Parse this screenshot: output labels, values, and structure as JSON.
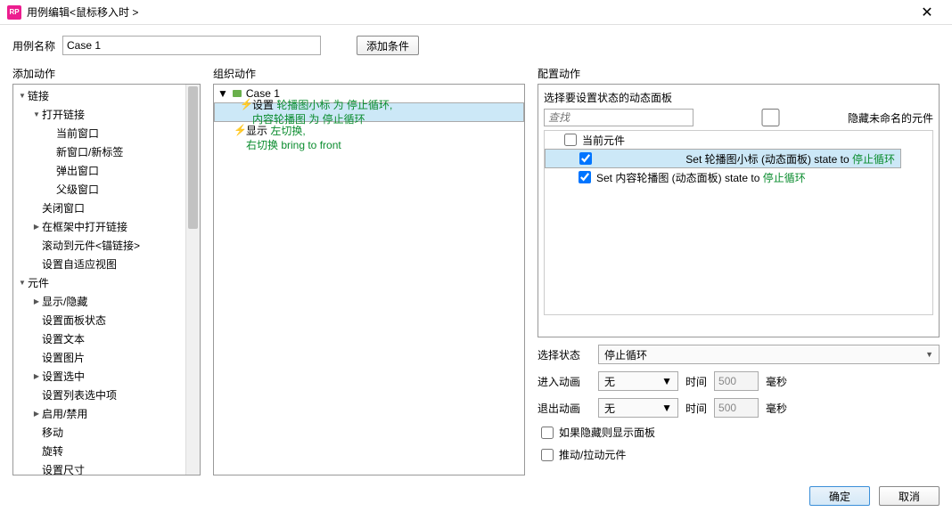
{
  "titlebar": {
    "app_icon_text": "RP",
    "title": "用例编辑<鼠标移入时 >",
    "close": "✕"
  },
  "namerow": {
    "label": "用例名称",
    "value": "Case 1",
    "add_condition": "添加条件"
  },
  "columns": {
    "add": "添加动作",
    "organize": "组织动作",
    "configure": "配置动作"
  },
  "tree": [
    {
      "lvl": 1,
      "tw": "down",
      "label": "链接"
    },
    {
      "lvl": 2,
      "tw": "down",
      "label": "打开链接"
    },
    {
      "lvl": 3,
      "tw": "",
      "label": "当前窗口"
    },
    {
      "lvl": 3,
      "tw": "",
      "label": "新窗口/新标签"
    },
    {
      "lvl": 3,
      "tw": "",
      "label": "弹出窗口"
    },
    {
      "lvl": 3,
      "tw": "",
      "label": "父级窗口"
    },
    {
      "lvl": 2,
      "tw": "",
      "label": "关闭窗口"
    },
    {
      "lvl": 2,
      "tw": "right",
      "label": "在框架中打开链接"
    },
    {
      "lvl": 2,
      "tw": "",
      "label": "滚动到元件<锚链接>"
    },
    {
      "lvl": 2,
      "tw": "",
      "label": "设置自适应视图"
    },
    {
      "lvl": 1,
      "tw": "down",
      "label": "元件"
    },
    {
      "lvl": 2,
      "tw": "right",
      "label": "显示/隐藏"
    },
    {
      "lvl": 2,
      "tw": "",
      "label": "设置面板状态"
    },
    {
      "lvl": 2,
      "tw": "",
      "label": "设置文本"
    },
    {
      "lvl": 2,
      "tw": "",
      "label": "设置图片"
    },
    {
      "lvl": 2,
      "tw": "right",
      "label": "设置选中"
    },
    {
      "lvl": 2,
      "tw": "",
      "label": "设置列表选中项"
    },
    {
      "lvl": 2,
      "tw": "right",
      "label": "启用/禁用"
    },
    {
      "lvl": 2,
      "tw": "",
      "label": "移动"
    },
    {
      "lvl": 2,
      "tw": "",
      "label": "旋转"
    },
    {
      "lvl": 2,
      "tw": "",
      "label": "设置尺寸"
    }
  ],
  "case": {
    "name": "Case 1",
    "actions": [
      {
        "sel": true,
        "verb": "设置",
        "lines": [
          "轮播图小标 为 停止循环,",
          "内容轮播图 为 停止循环"
        ]
      },
      {
        "sel": false,
        "verb": "显示",
        "lines": [
          "左切换,",
          "右切换 bring to front"
        ]
      }
    ]
  },
  "right": {
    "subtitle": "选择要设置状态的动态面板",
    "search_placeholder": "查找",
    "hide_unnamed": "隐藏未命名的元件",
    "items": [
      {
        "checked": false,
        "sub": false,
        "sel": false,
        "pre": "当前元件",
        "g": ""
      },
      {
        "checked": true,
        "sub": true,
        "sel": true,
        "pre": "Set 轮播图小标 (动态面板) state to ",
        "g": "停止循环"
      },
      {
        "checked": true,
        "sub": true,
        "sel": false,
        "pre": "Set 内容轮播图 (动态面板) state to ",
        "g": "停止循环"
      }
    ],
    "state_label": "选择状态",
    "state_value": "停止循环",
    "anim_in_label": "进入动画",
    "anim_out_label": "退出动画",
    "anim_none": "无",
    "time_label": "时间",
    "time_value": "500",
    "ms": "毫秒",
    "chk_show_if_hidden": "如果隐藏则显示面板",
    "chk_push_pull": "推动/拉动元件"
  },
  "footer": {
    "ok": "确定",
    "cancel": "取消"
  }
}
